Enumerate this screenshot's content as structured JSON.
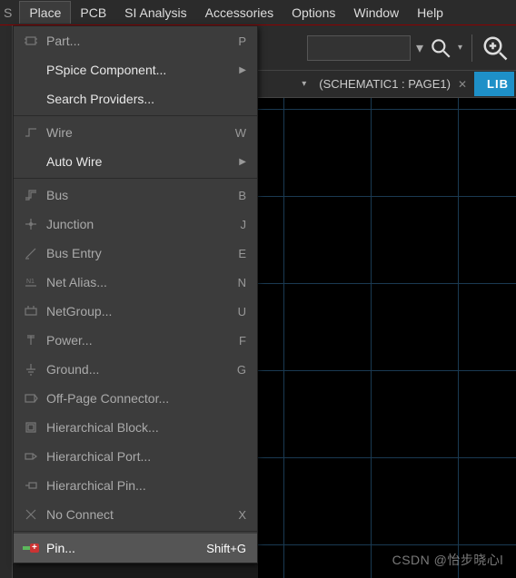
{
  "menubar": {
    "left_cut": "S",
    "items": [
      "Place",
      "PCB",
      "SI Analysis",
      "Accessories",
      "Options",
      "Window",
      "Help"
    ],
    "active_index": 0
  },
  "tabrow": {
    "tab_label": "(SCHEMATIC1 : PAGE1)",
    "lib_label": "LIB"
  },
  "menu": {
    "groups": [
      [
        {
          "icon": "part-icon",
          "label": "Part...",
          "shortcut": "P",
          "enabled": false
        },
        {
          "icon": "",
          "label": "PSpice Component...",
          "submenu": true,
          "enabled": true
        },
        {
          "icon": "",
          "label": "Search Providers...",
          "submenu": false,
          "enabled": true
        }
      ],
      [
        {
          "icon": "wire-icon",
          "label": "Wire",
          "shortcut": "W",
          "enabled": false
        },
        {
          "icon": "",
          "label": "Auto Wire",
          "submenu": true,
          "enabled": true
        }
      ],
      [
        {
          "icon": "bus-icon",
          "label": "Bus",
          "shortcut": "B",
          "enabled": false
        },
        {
          "icon": "junction-icon",
          "label": "Junction",
          "shortcut": "J",
          "enabled": false
        },
        {
          "icon": "busentry-icon",
          "label": "Bus Entry",
          "shortcut": "E",
          "enabled": false
        },
        {
          "icon": "netalias-icon",
          "label": "Net Alias...",
          "shortcut": "N",
          "enabled": false
        },
        {
          "icon": "netgroup-icon",
          "label": "NetGroup...",
          "shortcut": "U",
          "enabled": false
        },
        {
          "icon": "power-icon",
          "label": "Power...",
          "shortcut": "F",
          "enabled": false
        },
        {
          "icon": "ground-icon",
          "label": "Ground...",
          "shortcut": "G",
          "enabled": false
        },
        {
          "icon": "offpage-icon",
          "label": "Off-Page Connector...",
          "shortcut": "",
          "enabled": false
        },
        {
          "icon": "hierblock-icon",
          "label": "Hierarchical Block...",
          "shortcut": "",
          "enabled": false
        },
        {
          "icon": "hierport-icon",
          "label": "Hierarchical Port...",
          "shortcut": "",
          "enabled": false
        },
        {
          "icon": "hierpin-icon",
          "label": "Hierarchical Pin...",
          "shortcut": "",
          "enabled": false
        },
        {
          "icon": "noconnect-icon",
          "label": "No Connect",
          "shortcut": "X",
          "enabled": false
        }
      ],
      [
        {
          "icon": "pin-icon",
          "label": "Pin...",
          "shortcut": "Shift+G",
          "enabled": true,
          "hover": true
        }
      ]
    ]
  },
  "watermark": "CSDN @怡步晓心l"
}
